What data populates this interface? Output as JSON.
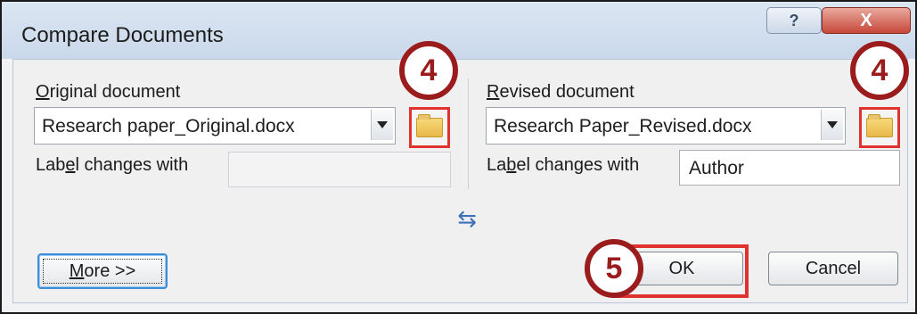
{
  "dialog": {
    "title": "Compare Documents",
    "help_label": "?",
    "close_label": "X"
  },
  "original": {
    "label_prefix": "",
    "label_accel": "O",
    "label_rest": "riginal document",
    "file": "Research paper_Original.docx",
    "label_changes_pre": "Lab",
    "label_changes_accel": "e",
    "label_changes_post": "l changes with",
    "label_changes_value": ""
  },
  "revised": {
    "label_accel": "R",
    "label_rest": "evised document",
    "file": "Research Paper_Revised.docx",
    "label_changes_pre": "La",
    "label_changes_accel": "b",
    "label_changes_post": "el changes with",
    "label_changes_value": "Author"
  },
  "buttons": {
    "more_accel": "M",
    "more_rest": "ore >>",
    "ok": "OK",
    "cancel": "Cancel"
  },
  "callouts": {
    "step_open_left": "4",
    "step_open_right": "4",
    "step_ok": "5"
  },
  "colors": {
    "callout_border": "#9b1c1c",
    "highlight": "#e0332f"
  },
  "icons": {
    "swap": "swap-arrows-icon",
    "browse": "folder-open-icon",
    "dropdown": "chevron-down-icon"
  }
}
